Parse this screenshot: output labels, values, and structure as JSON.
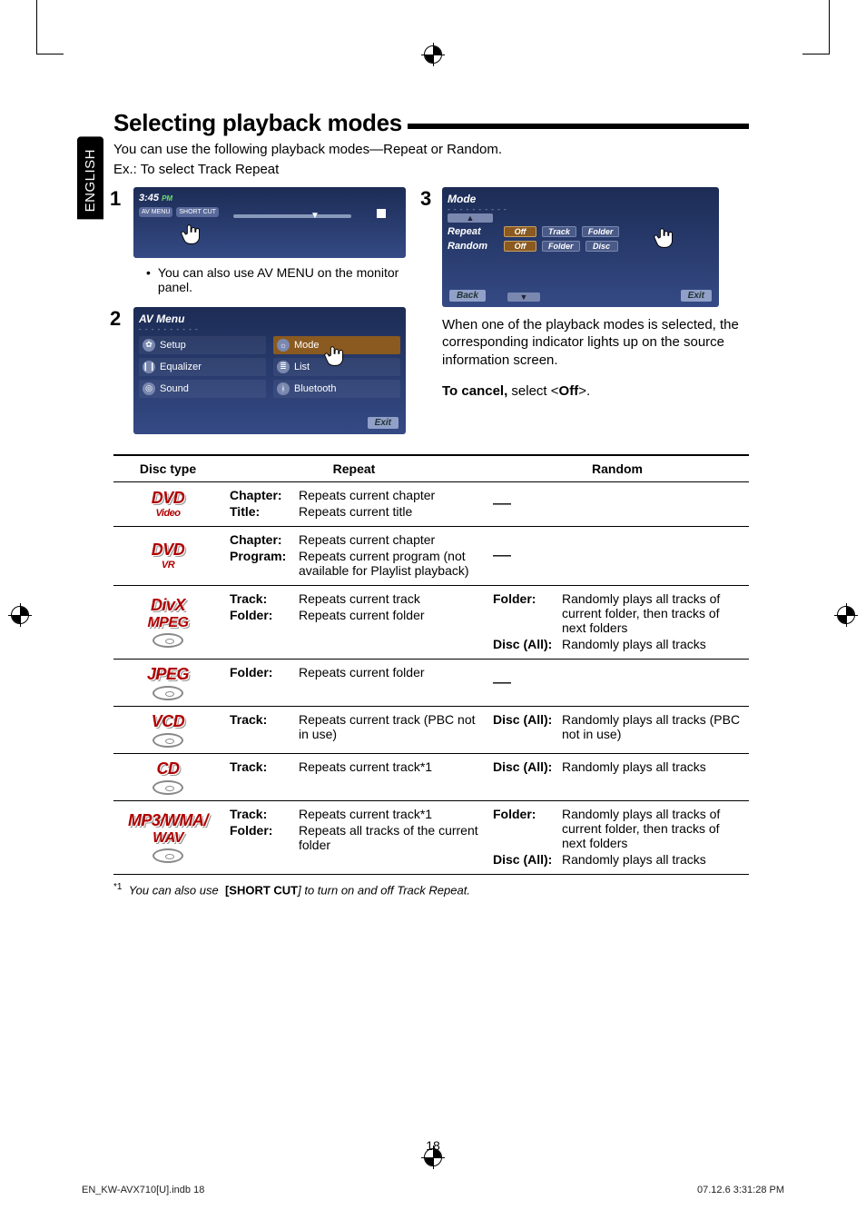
{
  "lang_tab": "ENGLISH",
  "section_title": "Selecting playback modes",
  "intro_line1": "You can use the following playback modes—Repeat or Random.",
  "intro_line2": "Ex.: To select Track Repeat",
  "steps": {
    "s1": {
      "num": "1",
      "screen": {
        "time": "3:45",
        "ampm": "PM",
        "badge_av": "AV MENU",
        "badge_short": "SHORT CUT"
      },
      "note": "You can also use AV MENU on the monitor panel."
    },
    "s2": {
      "num": "2",
      "panel_title": "AV Menu",
      "items": {
        "setup": "Setup",
        "equalizer": "Equalizer",
        "sound": "Sound",
        "mode": "Mode",
        "list": "List",
        "bluetooth": "Bluetooth"
      },
      "exit": "Exit"
    },
    "s3": {
      "num": "3",
      "panel_title": "Mode",
      "rows": {
        "repeat": {
          "label": "Repeat",
          "opts": [
            "Off",
            "Track",
            "Folder"
          ]
        },
        "random": {
          "label": "Random",
          "opts": [
            "Off",
            "Folder",
            "Disc"
          ]
        }
      },
      "back": "Back",
      "exit": "Exit",
      "explain": "When one of the playback modes is selected, the corresponding indicator lights up on the source information screen.",
      "cancel_label": "To cancel,",
      "cancel_rest": " select <",
      "cancel_off": "Off",
      "cancel_end": ">."
    }
  },
  "table": {
    "headers": {
      "disc": "Disc type",
      "repeat": "Repeat",
      "random": "Random"
    },
    "rows": [
      {
        "disc_label": "DVD",
        "disc_sub": "Video",
        "repeat": [
          {
            "k": "Chapter",
            "v": "Repeats current chapter"
          },
          {
            "k": "Title",
            "v": "Repeats current title"
          }
        ],
        "random_dash": true
      },
      {
        "disc_label": "DVD",
        "disc_sub": "VR",
        "repeat": [
          {
            "k": "Chapter",
            "v": "Repeats current chapter"
          },
          {
            "k": "Program",
            "v": "Repeats current program (not available for Playlist playback)"
          }
        ],
        "random_dash": true
      },
      {
        "disc_label": "DivX",
        "disc_sub2": "MPEG",
        "show_ellipse": true,
        "repeat": [
          {
            "k": "Track",
            "v": "Repeats current track"
          },
          {
            "k": "Folder",
            "v": "Repeats current folder"
          }
        ],
        "random": [
          {
            "k": "Folder",
            "v": "Randomly plays all tracks of current folder, then tracks of next folders"
          },
          {
            "k": "Disc (All)",
            "v": "Randomly plays all tracks"
          }
        ]
      },
      {
        "disc_label": "JPEG",
        "show_ellipse": true,
        "repeat": [
          {
            "k": "Folder",
            "v": "Repeats current folder"
          }
        ],
        "random_dash": true
      },
      {
        "disc_label": "VCD",
        "show_ellipse": true,
        "repeat": [
          {
            "k": "Track",
            "v": "Repeats current track (PBC not in use)"
          }
        ],
        "random": [
          {
            "k": "Disc (All)",
            "v": "Randomly plays all tracks (PBC not in use)"
          }
        ]
      },
      {
        "disc_label": "CD",
        "show_ellipse": true,
        "repeat": [
          {
            "k": "Track",
            "v": "Repeats current track*1"
          }
        ],
        "random": [
          {
            "k": "Disc (All)",
            "v": "Randomly plays all tracks"
          }
        ]
      },
      {
        "disc_label": "MP3/WMA/",
        "disc_sub3": "WAV",
        "show_ellipse": true,
        "repeat": [
          {
            "k": "Track",
            "v": "Repeats current track*1"
          },
          {
            "k": "Folder",
            "v": "Repeats all tracks of the current folder"
          }
        ],
        "random": [
          {
            "k": "Folder",
            "v": "Randomly plays all tracks of current folder, then tracks of next folders"
          },
          {
            "k": "Disc (All)",
            "v": "Randomly plays all tracks"
          }
        ]
      }
    ]
  },
  "footnote": {
    "marker": "*1",
    "text_before": "You can also use ",
    "bold": "[SHORT CUT",
    "text_after": "] to turn on and off Track Repeat."
  },
  "page_number": "18",
  "footer_left": "EN_KW-AVX710[U].indb   18",
  "footer_right": "07.12.6   3:31:28 PM"
}
